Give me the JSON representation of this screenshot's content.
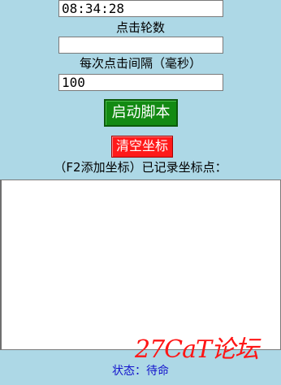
{
  "time_field": {
    "value": "08:34:28"
  },
  "clicks_label": "点击轮数",
  "clicks_field": {
    "value": ""
  },
  "interval_label": "每次点击间隔（毫秒）",
  "interval_field": {
    "value": "100"
  },
  "start_button": {
    "label": "启动脚本",
    "color": "#138a13"
  },
  "clear_button": {
    "label": "清空坐标",
    "color": "#ff1a1a"
  },
  "coords_label": "（F2添加坐标）已记录坐标点：",
  "coords_area": {
    "value": ""
  },
  "status": {
    "text": "状态：待命",
    "color": "#1414cc"
  },
  "watermark": {
    "text": "27CaT论坛",
    "color": "#ff1515"
  },
  "colors": {
    "background": "#add8e6"
  }
}
